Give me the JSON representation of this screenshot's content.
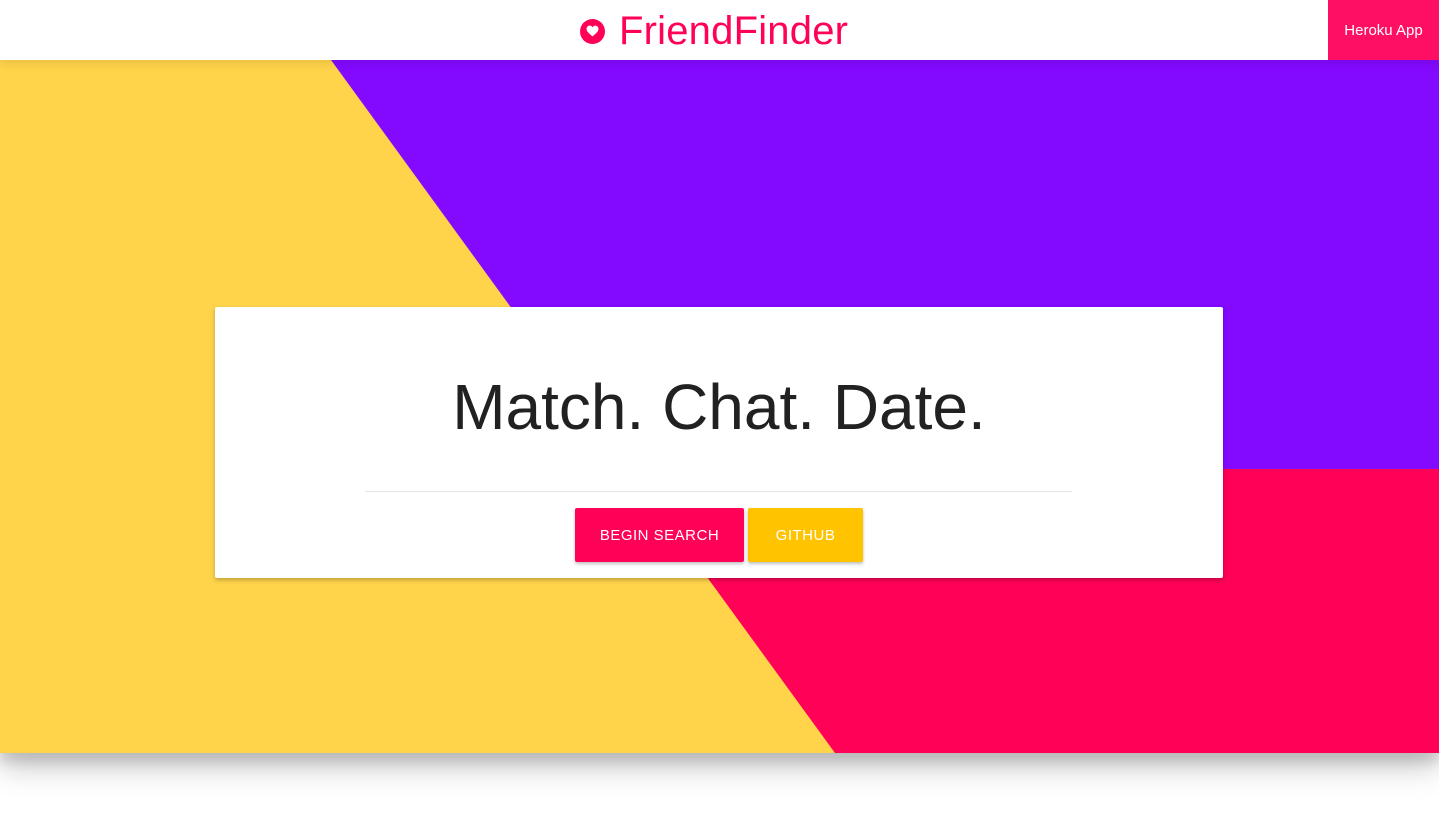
{
  "navbar": {
    "brand_text": "FriendFinder",
    "brand_icon": "heart-icon",
    "link_label": "Heroku App"
  },
  "hero": {
    "headline": "Match. Chat. Date.",
    "buttons": {
      "search_label": "BEGIN SEARCH",
      "github_label": "GITHUB"
    }
  },
  "colors": {
    "brand": "#ff0157",
    "yellow": "#ffd44a",
    "purple": "#8309ff",
    "github_button": "#ffc300"
  }
}
